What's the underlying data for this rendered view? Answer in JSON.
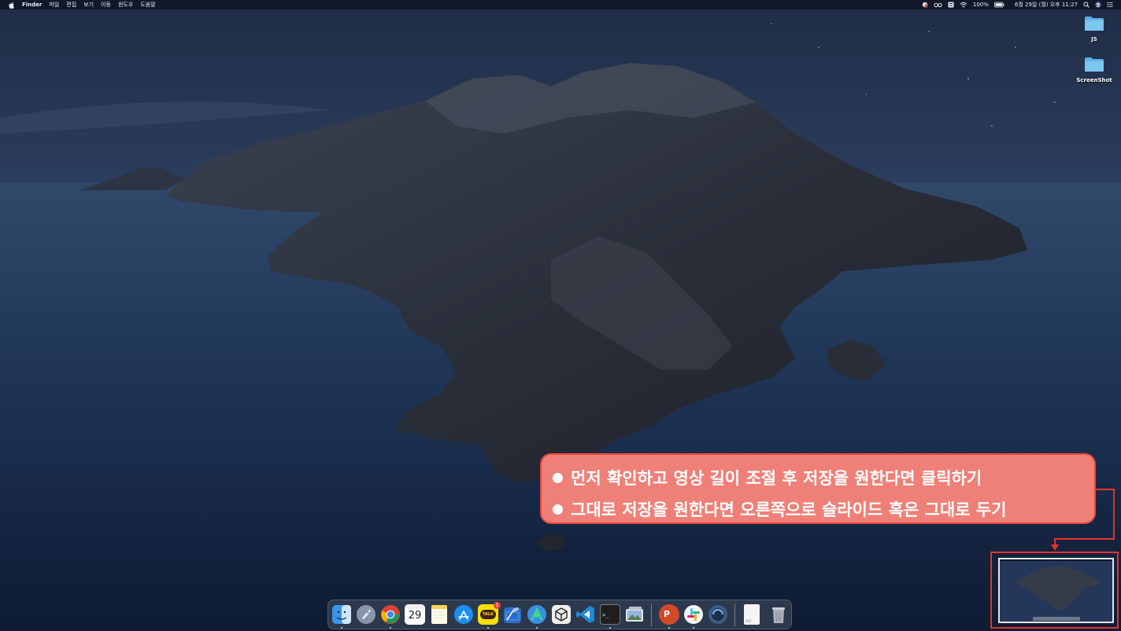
{
  "menubar": {
    "apple_icon": "apple-icon",
    "app_name": "Finder",
    "menus": [
      "파일",
      "편집",
      "보기",
      "이동",
      "윈도우",
      "도움말"
    ],
    "battery": "100%",
    "datetime": "6월 29일 (월) 오후 11:27"
  },
  "desktop_icons": [
    {
      "label": "JS",
      "icon": "folder-icon"
    },
    {
      "label": "ScreenShot",
      "icon": "folder-icon"
    }
  ],
  "callout": {
    "line1": "먼저 확인하고 영상 길이 조절 후 저장을 원한다면 클릭하기",
    "line2": "그대로 저장을 원한다면 오른쪽으로 슬라이드 혹은 그대로 두기"
  },
  "dock": {
    "calendar_day": "29",
    "kakao_label": "TALK",
    "kakao_badge": "1",
    "terminal_prompt": ">_",
    "powerpoint_letter": "P",
    "pdf_label": "PDF"
  },
  "colors": {
    "callout_fill": "#ee8078",
    "callout_border": "#e9463e",
    "highlight_red": "#e5322b"
  }
}
